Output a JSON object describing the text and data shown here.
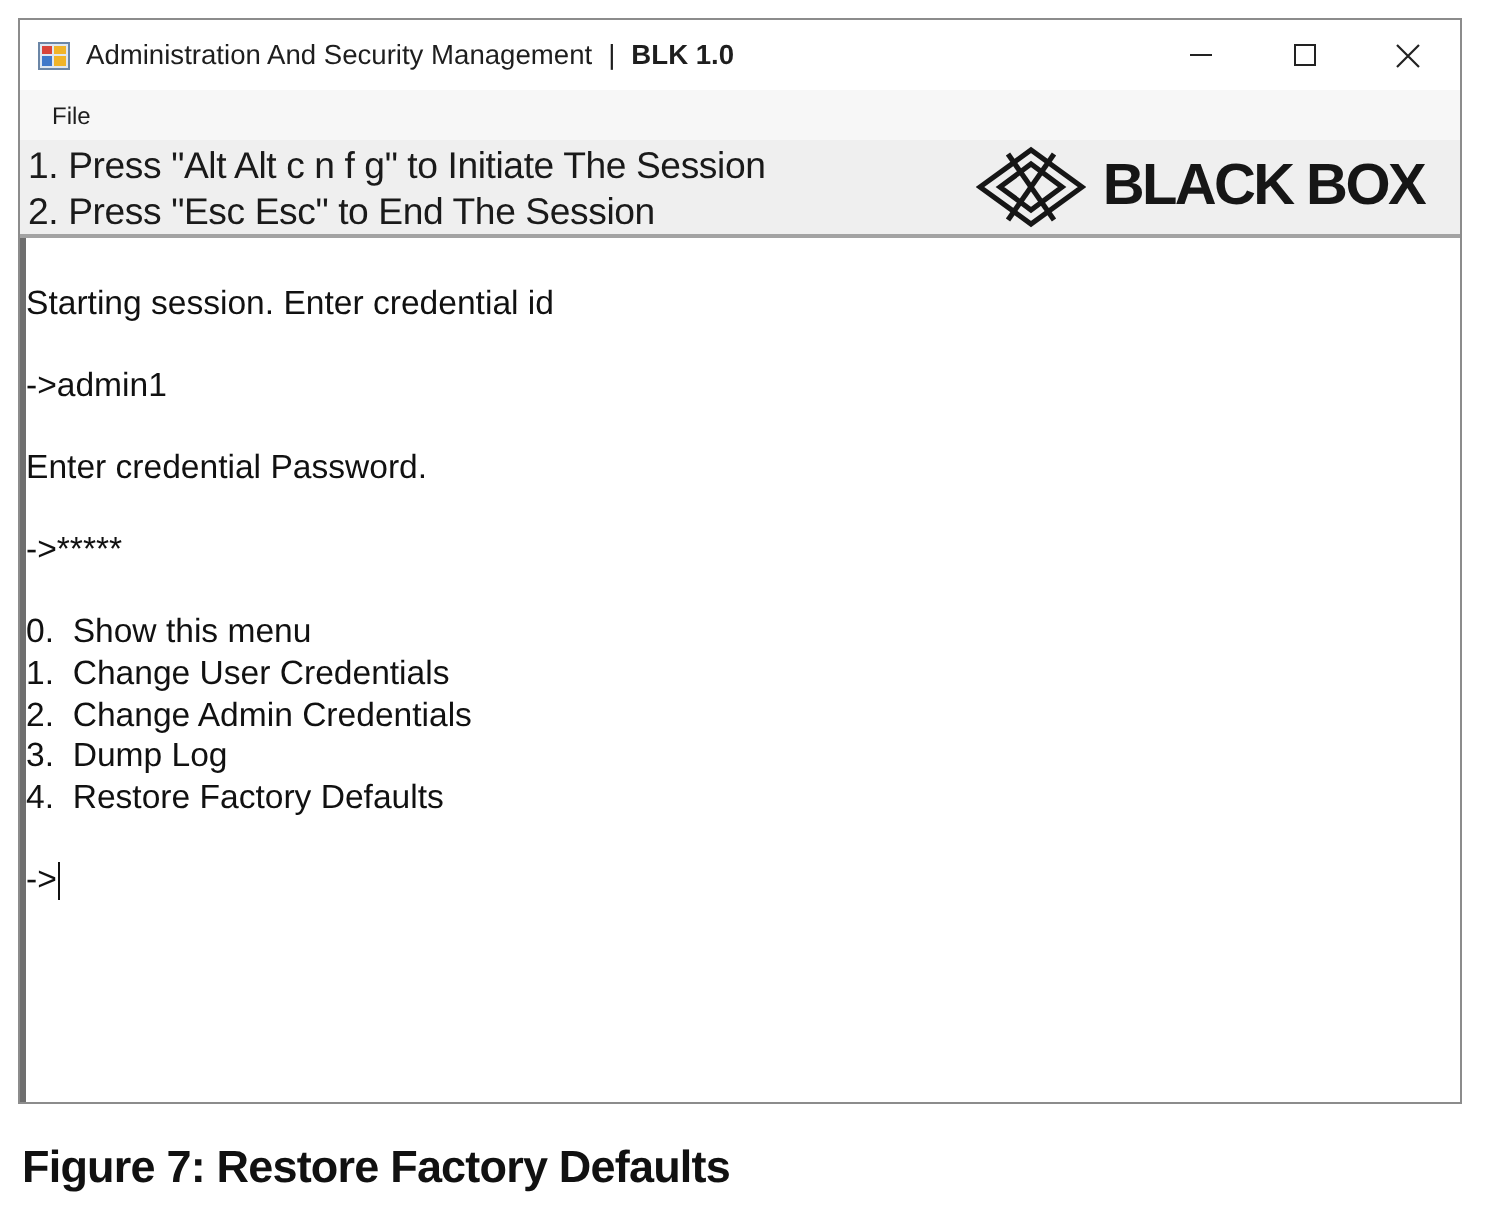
{
  "window": {
    "title": "Administration And Security Management",
    "separator": "|",
    "version": "BLK 1.0"
  },
  "menu": [
    {
      "label": "File"
    }
  ],
  "instructions": [
    "1. Press \"Alt Alt c n f g\" to Initiate The Session",
    "2. Press \"Esc Esc\" to End The Session"
  ],
  "logo": {
    "text": "BLACK BOX"
  },
  "console": {
    "groups": [
      [
        "Starting session. Enter credential id"
      ],
      [
        "->admin1"
      ],
      [
        "Enter credential Password."
      ],
      [
        "->*****"
      ],
      [
        "0.  Show this menu",
        "1.  Change User Credentials",
        "2.  Change Admin Credentials",
        "3.  Dump Log",
        "4.  Restore Factory Defaults"
      ]
    ],
    "prompt": {
      "text": "->",
      "cursor": true
    }
  },
  "caption": "Figure 7: Restore Factory Defaults"
}
